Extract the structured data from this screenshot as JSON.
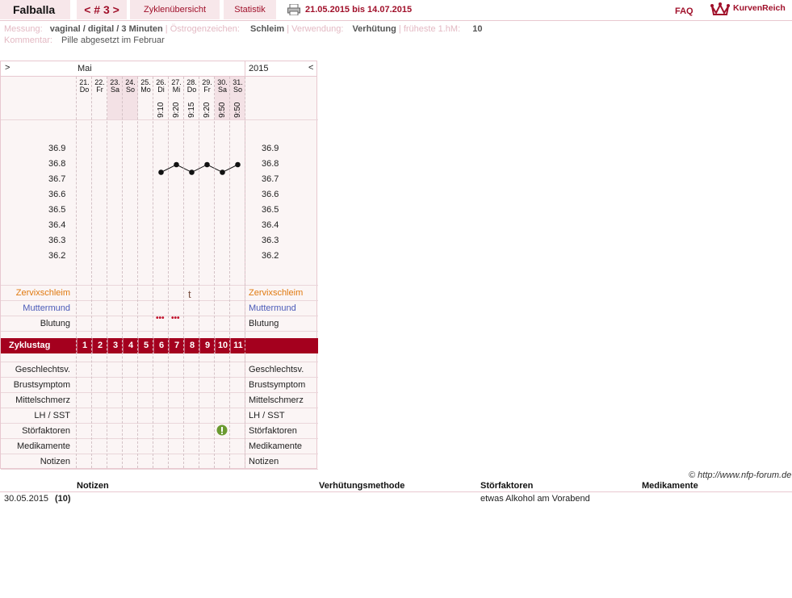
{
  "header": {
    "user_name": "Falballa",
    "cycle_label": "< # 3 >",
    "tab_overview": "Zyklenübersicht",
    "tab_stats": "Statistik",
    "date_range": "21.05.2015 bis 14.07.2015",
    "faq": "FAQ",
    "logo_text": "KurvenReich"
  },
  "meta": {
    "measure_label": "Messung:",
    "measure_value": "vaginal / digital / 3 Minuten",
    "estrogen_label": "Östrogenzeichen:",
    "estrogen_value": "Schleim",
    "usage_label": "Verwendung:",
    "usage_value": "Verhütung",
    "earliest_label": "früheste 1.hM:",
    "earliest_value": "10",
    "comment_label": "Kommentar:",
    "comment_value": "Pille abgesetzt im Februar"
  },
  "chart": {
    "nav_left": ">",
    "nav_right": "<",
    "month": "Mai",
    "year": "2015",
    "days": [
      {
        "date": "21.",
        "weekday": "Do",
        "time": ""
      },
      {
        "date": "22.",
        "weekday": "Fr",
        "time": ""
      },
      {
        "date": "23.",
        "weekday": "Sa",
        "time": ""
      },
      {
        "date": "24.",
        "weekday": "So",
        "time": ""
      },
      {
        "date": "25.",
        "weekday": "Mo",
        "time": ""
      },
      {
        "date": "26.",
        "weekday": "Di",
        "time": "9:10"
      },
      {
        "date": "27.",
        "weekday": "Mi",
        "time": "9:20"
      },
      {
        "date": "28.",
        "weekday": "Do",
        "time": "9:15"
      },
      {
        "date": "29.",
        "weekday": "Fr",
        "time": "9:20"
      },
      {
        "date": "30.",
        "weekday": "Sa",
        "time": "9:50"
      },
      {
        "date": "31.",
        "weekday": "So",
        "time": "9:50"
      }
    ],
    "temp_labels": [
      "36.9",
      "36.8",
      "36.7",
      "36.6",
      "36.5",
      "36.4",
      "36.3",
      "36.2"
    ],
    "rows_mid": {
      "zervix": "Zervixschleim",
      "muttermund": "Muttermund",
      "blutung": "Blutung",
      "zervix_mark": "t",
      "bleeding_mark": "•••"
    },
    "zyklustag_label": "Zyklustag",
    "cycle_days": [
      "1",
      "2",
      "3",
      "4",
      "5",
      "6",
      "7",
      "8",
      "9",
      "10",
      "11"
    ],
    "rows_low": [
      "Geschlechtsv.",
      "Brustsymptom",
      "Mittelschmerz",
      "LH / SST",
      "Störfaktoren",
      "Medikamente",
      "Notizen"
    ],
    "colors": {
      "accent": "#a4001e",
      "zervix": "#e07a10",
      "muttermund": "#4a5ab8",
      "alert": "#6a9a30"
    }
  },
  "chart_data": {
    "type": "line",
    "x": [
      "21.",
      "22.",
      "23.",
      "24.",
      "25.",
      "26.",
      "27.",
      "28.",
      "29.",
      "30.",
      "31."
    ],
    "series": [
      {
        "values": [
          null,
          null,
          null,
          null,
          null,
          36.75,
          36.8,
          36.75,
          36.8,
          36.75,
          36.8
        ]
      }
    ],
    "ylim": [
      36.2,
      36.9
    ]
  },
  "footer": {
    "copyright": "© http://www.nfp-forum.de",
    "columns": [
      "Notizen",
      "Verhütungsmethode",
      "Störfaktoren",
      "Medikamente"
    ],
    "row_date": "30.05.2015",
    "row_day": "(10)",
    "row_stoerfaktoren": "etwas Alkohol am Vorabend"
  }
}
